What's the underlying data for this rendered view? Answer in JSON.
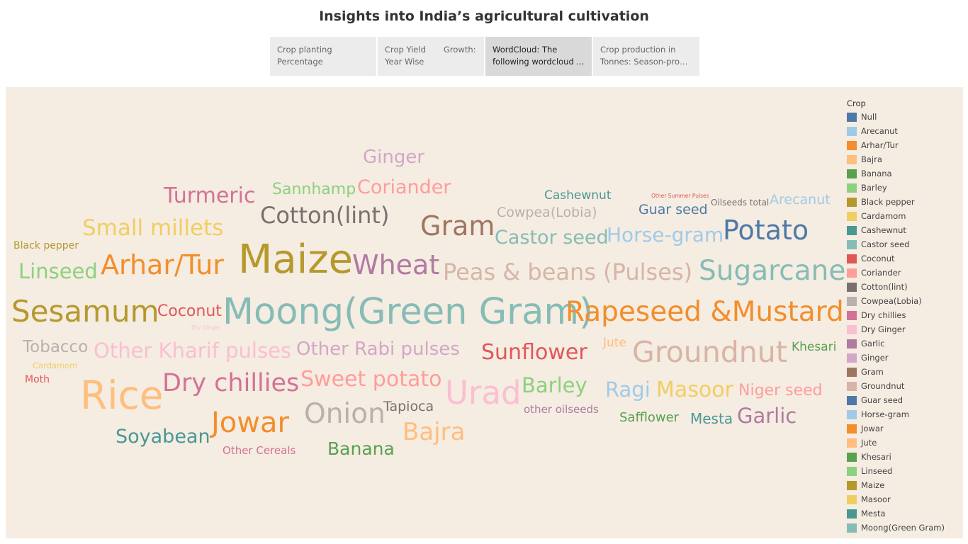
{
  "title": "Insights into India’s agricultural cultivation",
  "tabs": [
    {
      "line1": "Crop planting",
      "line2": "Percentage",
      "extra": ""
    },
    {
      "line1": "Crop Yield",
      "line2": "Year Wise",
      "extra": "Growth:"
    },
    {
      "line1": "WordCloud: The",
      "line2": "following wordcloud ...",
      "extra": ""
    },
    {
      "line1": "Crop production in",
      "line2": "Tonnes: Season-prod...",
      "extra": ""
    }
  ],
  "active_tab": 2,
  "legend": {
    "title": "Crop",
    "items": [
      {
        "label": "Null",
        "color": "#4e79a7"
      },
      {
        "label": "Arecanut",
        "color": "#a0cbe8"
      },
      {
        "label": "Arhar/Tur",
        "color": "#f28e2b"
      },
      {
        "label": "Bajra",
        "color": "#ffbe7d"
      },
      {
        "label": "Banana",
        "color": "#59a14f"
      },
      {
        "label": "Barley",
        "color": "#8cd17d"
      },
      {
        "label": "Black pepper",
        "color": "#b6992d"
      },
      {
        "label": "Cardamom",
        "color": "#f1ce63"
      },
      {
        "label": "Cashewnut",
        "color": "#499894"
      },
      {
        "label": "Castor seed",
        "color": "#86bcb6"
      },
      {
        "label": "Coconut",
        "color": "#e15759"
      },
      {
        "label": "Coriander",
        "color": "#ff9d9a"
      },
      {
        "label": "Cotton(lint)",
        "color": "#79706e"
      },
      {
        "label": "Cowpea(Lobia)",
        "color": "#bab0ac"
      },
      {
        "label": "Dry chillies",
        "color": "#d37295"
      },
      {
        "label": "Dry Ginger",
        "color": "#fabfd2"
      },
      {
        "label": "Garlic",
        "color": "#b07aa1"
      },
      {
        "label": "Ginger",
        "color": "#d4a6c8"
      },
      {
        "label": "Gram",
        "color": "#9d7660"
      },
      {
        "label": "Groundnut",
        "color": "#d7b5a6"
      },
      {
        "label": "Guar seed",
        "color": "#4e79a7"
      },
      {
        "label": "Horse-gram",
        "color": "#a0cbe8"
      },
      {
        "label": "Jowar",
        "color": "#f28e2b"
      },
      {
        "label": "Jute",
        "color": "#ffbe7d"
      },
      {
        "label": "Khesari",
        "color": "#59a14f"
      },
      {
        "label": "Linseed",
        "color": "#8cd17d"
      },
      {
        "label": "Maize",
        "color": "#b6992d"
      },
      {
        "label": "Masoor",
        "color": "#f1ce63"
      },
      {
        "label": "Mesta",
        "color": "#499894"
      },
      {
        "label": "Moong(Green Gram)",
        "color": "#86bcb6"
      }
    ]
  },
  "words": [
    {
      "text": "Ginger",
      "color": "#d4a6c8"
    },
    {
      "text": "Turmeric",
      "color": "#d37295"
    },
    {
      "text": "Sannhamp",
      "color": "#8cd17d"
    },
    {
      "text": "Coriander",
      "color": "#ff9d9a"
    },
    {
      "text": "Cashewnut",
      "color": "#499894"
    },
    {
      "text": "Other Summer Pulses",
      "color": "#e15759"
    },
    {
      "text": "Oilseeds total",
      "color": "#79706e"
    },
    {
      "text": "Arecanut",
      "color": "#a0cbe8"
    },
    {
      "text": "Cotton(lint)",
      "color": "#79706e"
    },
    {
      "text": "Cowpea(Lobia)",
      "color": "#bab0ac"
    },
    {
      "text": "Guar seed",
      "color": "#4e79a7"
    },
    {
      "text": "Small millets",
      "color": "#f1ce63"
    },
    {
      "text": "Gram",
      "color": "#9d7660"
    },
    {
      "text": "Castor seed",
      "color": "#86bcb6"
    },
    {
      "text": "Horse-gram",
      "color": "#a0cbe8"
    },
    {
      "text": "Potato",
      "color": "#4e79a7"
    },
    {
      "text": "Black pepper",
      "color": "#b6992d"
    },
    {
      "text": "Maize",
      "color": "#b6992d"
    },
    {
      "text": "Linseed",
      "color": "#8cd17d"
    },
    {
      "text": "Arhar/Tur",
      "color": "#f28e2b"
    },
    {
      "text": "Wheat",
      "color": "#b07aa1"
    },
    {
      "text": "Peas & beans (Pulses)",
      "color": "#d7b5a6"
    },
    {
      "text": "Sugarcane",
      "color": "#86bcb6"
    },
    {
      "text": "Sesamum",
      "color": "#b6992d"
    },
    {
      "text": "Coconut",
      "color": "#e15759"
    },
    {
      "text": "Moong(Green Gram)",
      "color": "#86bcb6"
    },
    {
      "text": "Rapeseed &Mustard",
      "color": "#f28e2b"
    },
    {
      "text": "Dry Ginger",
      "color": "#fabfd2"
    },
    {
      "text": "Tobacco",
      "color": "#bab0ac"
    },
    {
      "text": "Other Kharif pulses",
      "color": "#fabfd2"
    },
    {
      "text": "Other Rabi pulses",
      "color": "#d4a6c8"
    },
    {
      "text": "Jute",
      "color": "#ffbe7d"
    },
    {
      "text": "Sunflower",
      "color": "#e15759"
    },
    {
      "text": "Groundnut",
      "color": "#d7b5a6"
    },
    {
      "text": "Khesari",
      "color": "#59a14f"
    },
    {
      "text": "Cardamom",
      "color": "#f1ce63"
    },
    {
      "text": "Moth",
      "color": "#e15759"
    },
    {
      "text": "Rice",
      "color": "#ffbe7d"
    },
    {
      "text": "Dry chillies",
      "color": "#d37295"
    },
    {
      "text": "Sweet potato",
      "color": "#ff9d9a"
    },
    {
      "text": "Urad",
      "color": "#fabfd2"
    },
    {
      "text": "Barley",
      "color": "#8cd17d"
    },
    {
      "text": "Ragi",
      "color": "#a0cbe8"
    },
    {
      "text": "Masoor",
      "color": "#f1ce63"
    },
    {
      "text": "Niger seed",
      "color": "#ff9d9a"
    },
    {
      "text": "Tapioca",
      "color": "#79706e"
    },
    {
      "text": "other oilseeds",
      "color": "#b07aa1"
    },
    {
      "text": "Onion",
      "color": "#bab0ac"
    },
    {
      "text": "Jowar",
      "color": "#f28e2b"
    },
    {
      "text": "Safflower",
      "color": "#59a14f"
    },
    {
      "text": "Mesta",
      "color": "#499894"
    },
    {
      "text": "Garlic",
      "color": "#b07aa1"
    },
    {
      "text": "Soyabean",
      "color": "#499894"
    },
    {
      "text": "Bajra",
      "color": "#ffbe7d"
    },
    {
      "text": "Other Cereals",
      "color": "#d37295"
    },
    {
      "text": "Banana",
      "color": "#59a14f"
    }
  ]
}
